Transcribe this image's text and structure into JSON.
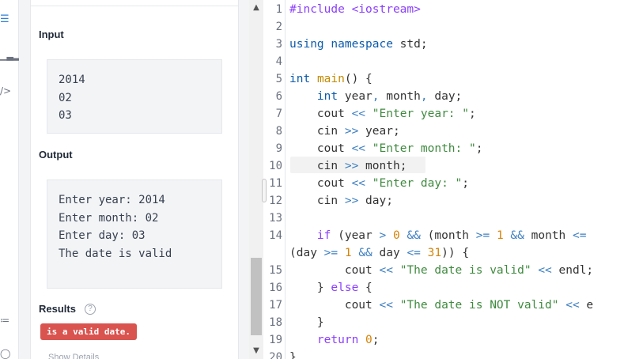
{
  "sidebar": {
    "icons": [
      "list-icon",
      "chart-icon",
      "code-icon",
      "share-icon",
      "help-icon"
    ]
  },
  "problem": {
    "input_title": "Input",
    "input_lines": [
      "2014",
      "02",
      "03"
    ],
    "output_title": "Output",
    "output_lines": [
      "Enter year: 2014",
      "Enter month: 02",
      "Enter day: 03",
      "The date is valid"
    ],
    "results_title": "Results",
    "results_help": "?",
    "result_badge": "is a valid date.",
    "faded_text": "Show Details"
  },
  "colors": {
    "badge": "#d9534f",
    "keyword": "#8a3ffc",
    "type": "#0b5cad",
    "string": "#3f8a3f",
    "operator": "#3d7fc2",
    "number": "#d4850b"
  },
  "editor": {
    "active_line": 10,
    "lines": [
      {
        "n": "1",
        "parts": [
          [
            "pp",
            "#include <iostream>"
          ]
        ]
      },
      {
        "n": "2",
        "parts": []
      },
      {
        "n": "3",
        "parts": [
          [
            "ty",
            "using namespace"
          ],
          [
            "",
            " std;"
          ]
        ]
      },
      {
        "n": "4",
        "parts": []
      },
      {
        "n": "5",
        "parts": [
          [
            "ty",
            "int"
          ],
          [
            "",
            " "
          ],
          [
            "fn",
            "main"
          ],
          [
            "",
            "() {"
          ]
        ]
      },
      {
        "n": "6",
        "parts": [
          [
            "",
            "    "
          ],
          [
            "ty",
            "int"
          ],
          [
            "",
            " year"
          ],
          [
            "op",
            ","
          ],
          [
            "",
            " month"
          ],
          [
            "op",
            ","
          ],
          [
            "",
            " day;"
          ]
        ]
      },
      {
        "n": "7",
        "parts": [
          [
            "",
            "    cout "
          ],
          [
            "op",
            "<<"
          ],
          [
            "",
            " "
          ],
          [
            "str",
            "\"Enter year: \""
          ],
          [
            "",
            ";"
          ]
        ]
      },
      {
        "n": "8",
        "parts": [
          [
            "",
            "    cin "
          ],
          [
            "op",
            ">>"
          ],
          [
            "",
            " year;"
          ]
        ]
      },
      {
        "n": "9",
        "parts": [
          [
            "",
            "    cout "
          ],
          [
            "op",
            "<<"
          ],
          [
            "",
            " "
          ],
          [
            "str",
            "\"Enter month: \""
          ],
          [
            "",
            ";"
          ]
        ]
      },
      {
        "n": "10",
        "parts": [
          [
            "",
            "    cin "
          ],
          [
            "op",
            ">>"
          ],
          [
            "",
            " month;"
          ]
        ]
      },
      {
        "n": "11",
        "parts": [
          [
            "",
            "    cout "
          ],
          [
            "op",
            "<<"
          ],
          [
            "",
            " "
          ],
          [
            "str",
            "\"Enter day: \""
          ],
          [
            "",
            ";"
          ]
        ]
      },
      {
        "n": "12",
        "parts": [
          [
            "",
            "    cin "
          ],
          [
            "op",
            ">>"
          ],
          [
            "",
            " day;"
          ]
        ]
      },
      {
        "n": "13",
        "parts": []
      },
      {
        "n": "14",
        "parts": [
          [
            "",
            "    "
          ],
          [
            "kw",
            "if"
          ],
          [
            "",
            " (year "
          ],
          [
            "op",
            ">"
          ],
          [
            "",
            " "
          ],
          [
            "nm",
            "0"
          ],
          [
            "",
            " "
          ],
          [
            "op",
            "&&"
          ],
          [
            "",
            " (month "
          ],
          [
            "op",
            ">="
          ],
          [
            "",
            " "
          ],
          [
            "nm",
            "1"
          ],
          [
            "",
            " "
          ],
          [
            "op",
            "&&"
          ],
          [
            "",
            " month "
          ],
          [
            "op",
            "<="
          ]
        ]
      },
      {
        "n": "",
        "parts": [
          [
            "",
            "(day "
          ],
          [
            "op",
            ">="
          ],
          [
            "",
            " "
          ],
          [
            "nm",
            "1"
          ],
          [
            "",
            " "
          ],
          [
            "op",
            "&&"
          ],
          [
            "",
            " day "
          ],
          [
            "op",
            "<="
          ],
          [
            "",
            " "
          ],
          [
            "nm",
            "31"
          ],
          [
            "",
            ")) {"
          ]
        ]
      },
      {
        "n": "15",
        "parts": [
          [
            "",
            "        cout "
          ],
          [
            "op",
            "<<"
          ],
          [
            "",
            " "
          ],
          [
            "str",
            "\"The date is valid\""
          ],
          [
            "",
            " "
          ],
          [
            "op",
            "<<"
          ],
          [
            "",
            " endl;"
          ]
        ]
      },
      {
        "n": "16",
        "parts": [
          [
            "",
            "    } "
          ],
          [
            "kw",
            "else"
          ],
          [
            "",
            " {"
          ]
        ]
      },
      {
        "n": "17",
        "parts": [
          [
            "",
            "        cout "
          ],
          [
            "op",
            "<<"
          ],
          [
            "",
            " "
          ],
          [
            "str",
            "\"The date is NOT valid\""
          ],
          [
            "",
            " "
          ],
          [
            "op",
            "<<"
          ],
          [
            "",
            " e"
          ]
        ]
      },
      {
        "n": "18",
        "parts": [
          [
            "",
            "    }"
          ]
        ]
      },
      {
        "n": "19",
        "parts": [
          [
            "",
            "    "
          ],
          [
            "kw",
            "return"
          ],
          [
            "",
            " "
          ],
          [
            "nm",
            "0"
          ],
          [
            "",
            ";"
          ]
        ]
      },
      {
        "n": "20",
        "parts": [
          [
            "",
            "}"
          ]
        ]
      }
    ]
  }
}
